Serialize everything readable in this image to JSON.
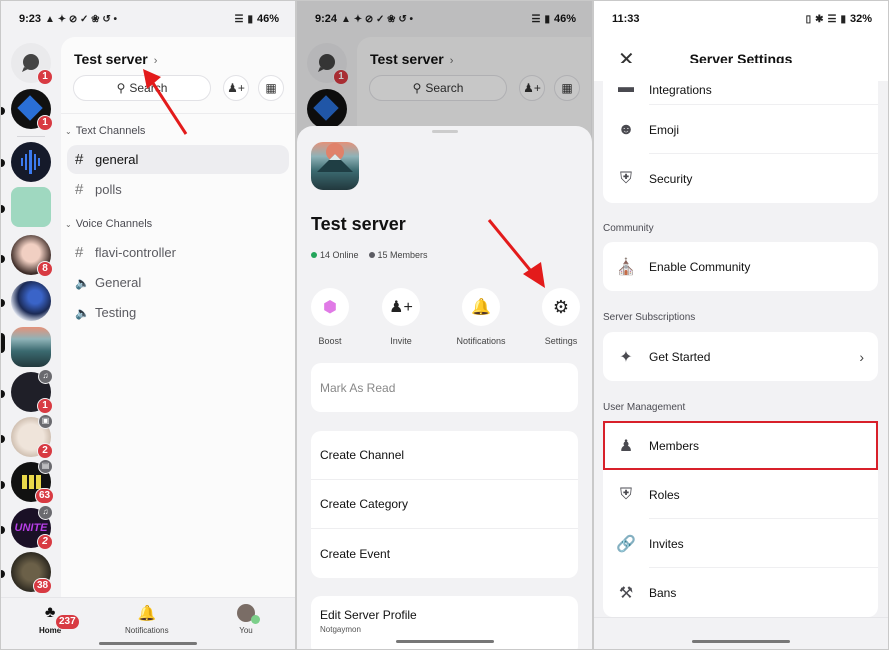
{
  "panel1": {
    "status": {
      "time": "9:23",
      "battery": "46%"
    },
    "server_name": "Test server",
    "search_label": "Search",
    "rail": {
      "dm_badge": "1",
      "guild_badges": [
        "1",
        "",
        "",
        "8",
        "",
        "",
        "1",
        "2",
        "63",
        "2",
        "38"
      ]
    },
    "categories": [
      {
        "label": "Text Channels",
        "channels": [
          {
            "name": "general",
            "type": "text",
            "active": true
          },
          {
            "name": "polls",
            "type": "text"
          }
        ]
      },
      {
        "label": "Voice Channels",
        "channels": [
          {
            "name": "flavi-controller",
            "type": "text"
          },
          {
            "name": "General",
            "type": "voice"
          },
          {
            "name": "Testing",
            "type": "voice"
          }
        ]
      }
    ],
    "nav": {
      "home": "Home",
      "home_badge": "237",
      "notifications": "Notifications",
      "you": "You"
    }
  },
  "panel2": {
    "status": {
      "time": "9:24",
      "battery": "46%"
    },
    "server_name": "Test server",
    "search_label": "Search",
    "sheet": {
      "title": "Test server",
      "online": "14 Online",
      "members": "15 Members",
      "actions": [
        "Boost",
        "Invite",
        "Notifications",
        "Settings"
      ],
      "mark_read": "Mark As Read",
      "create": [
        "Create Channel",
        "Create Category",
        "Create Event"
      ],
      "edit_profile": "Edit Server Profile",
      "edit_profile_sub": "Notgaymon"
    },
    "colors": {
      "online": "#23a55a",
      "members": "#5c5c63"
    }
  },
  "panel3": {
    "status": {
      "time": "11:33",
      "battery": "32%"
    },
    "title": "Server Settings",
    "top_items": [
      "Integrations",
      "Emoji",
      "Security"
    ],
    "community_label": "Community",
    "community_items": [
      "Enable Community"
    ],
    "subs_label": "Server Subscriptions",
    "subs_items": [
      "Get Started"
    ],
    "user_mgmt_label": "User Management",
    "user_mgmt_items": [
      "Members",
      "Roles",
      "Invites",
      "Bans"
    ],
    "highlight_color": "#d8202a"
  }
}
